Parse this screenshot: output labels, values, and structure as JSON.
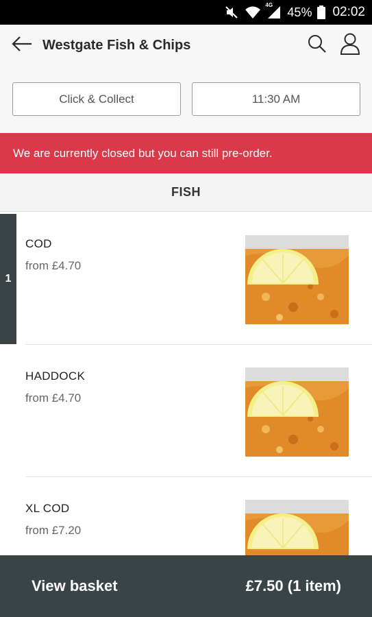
{
  "status_bar": {
    "battery": "45%",
    "network": "4G",
    "time": "02:02",
    "icons": [
      "mute-icon",
      "wifi-icon",
      "signal-icon",
      "battery-icon"
    ]
  },
  "header": {
    "title": "Westgate Fish & Chips",
    "icons": [
      "back-arrow-icon",
      "search-icon",
      "user-icon"
    ]
  },
  "order_options": {
    "method": "Click & Collect",
    "time": "11:30 AM"
  },
  "banner": {
    "text": "We are currently closed but you can still pre-order.",
    "color": "#d9394a"
  },
  "section": {
    "title": "FISH"
  },
  "items": [
    {
      "name": "COD",
      "price": "from £4.70",
      "qty": "1"
    },
    {
      "name": "HADDOCK",
      "price": "from £4.70",
      "qty": ""
    },
    {
      "name": "XL COD",
      "price": "from £7.20",
      "qty": ""
    }
  ],
  "basket": {
    "label": "View basket",
    "total": "£7.50 (1 item)",
    "color": "#3a4446"
  }
}
